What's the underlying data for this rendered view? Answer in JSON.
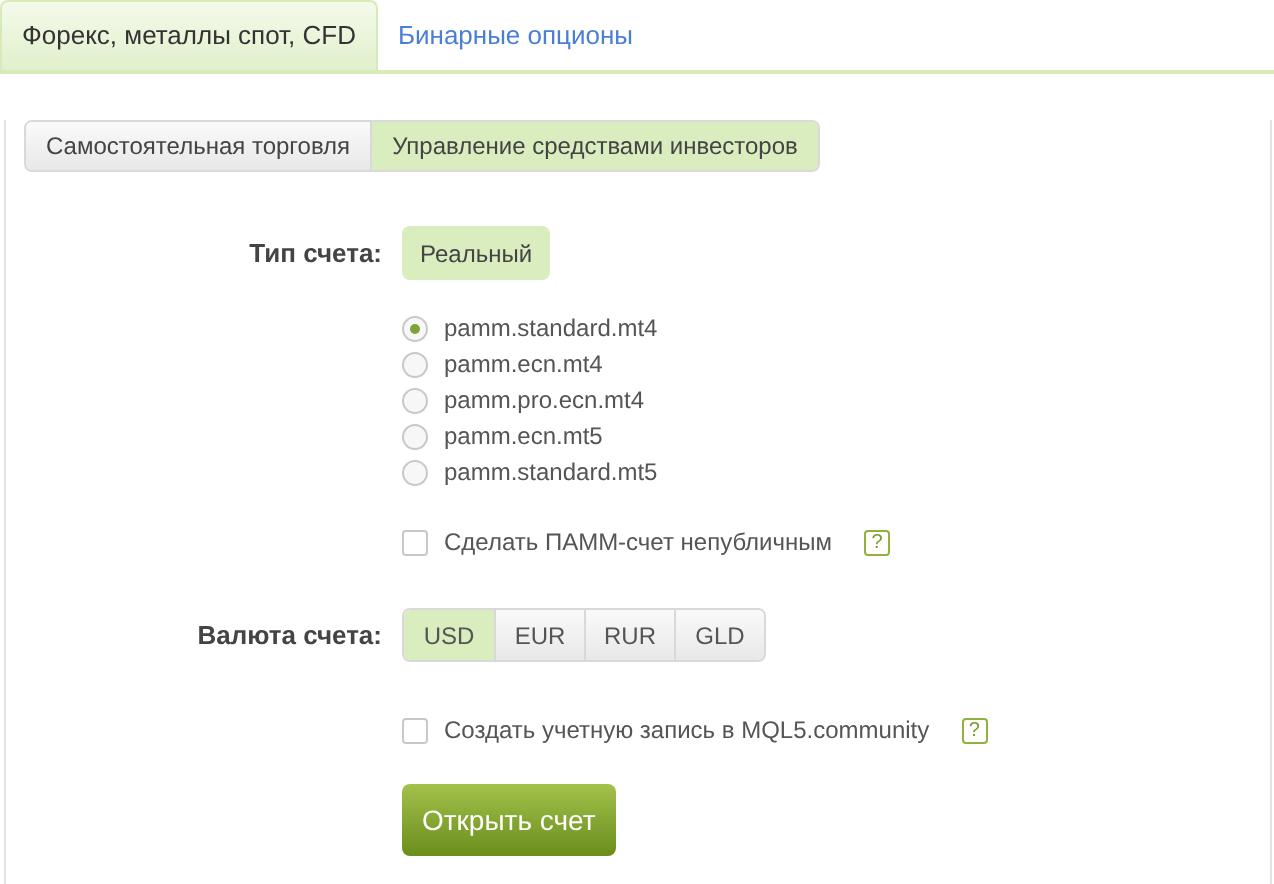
{
  "tabs": [
    {
      "label": "Форекс, металлы спот, CFD",
      "selected": true
    },
    {
      "label": "Бинарные опционы",
      "selected": false
    }
  ],
  "mode_switch": [
    {
      "label": "Самостоятельная торговля",
      "selected": false
    },
    {
      "label": "Управление средствами инвесторов",
      "selected": true
    }
  ],
  "account_type": {
    "label": "Тип счета:",
    "options": [
      {
        "label": "Реальный",
        "selected": true
      }
    ]
  },
  "servers": [
    {
      "label": "pamm.standard.mt4",
      "selected": true
    },
    {
      "label": "pamm.ecn.mt4",
      "selected": false
    },
    {
      "label": "pamm.pro.ecn.mt4",
      "selected": false
    },
    {
      "label": "pamm.ecn.mt5",
      "selected": false
    },
    {
      "label": "pamm.standard.mt5",
      "selected": false
    }
  ],
  "private_option": {
    "label": "Сделать ПАММ-счет непубличным",
    "checked": false,
    "help": "?"
  },
  "currency": {
    "label": "Валюта счета:",
    "options": [
      {
        "label": "USD",
        "selected": true
      },
      {
        "label": "EUR",
        "selected": false
      },
      {
        "label": "RUR",
        "selected": false
      },
      {
        "label": "GLD",
        "selected": false
      }
    ]
  },
  "community_option": {
    "label": "Создать учетную запись в MQL5.community",
    "checked": false,
    "help": "?"
  },
  "submit": {
    "label": "Открыть счет"
  }
}
